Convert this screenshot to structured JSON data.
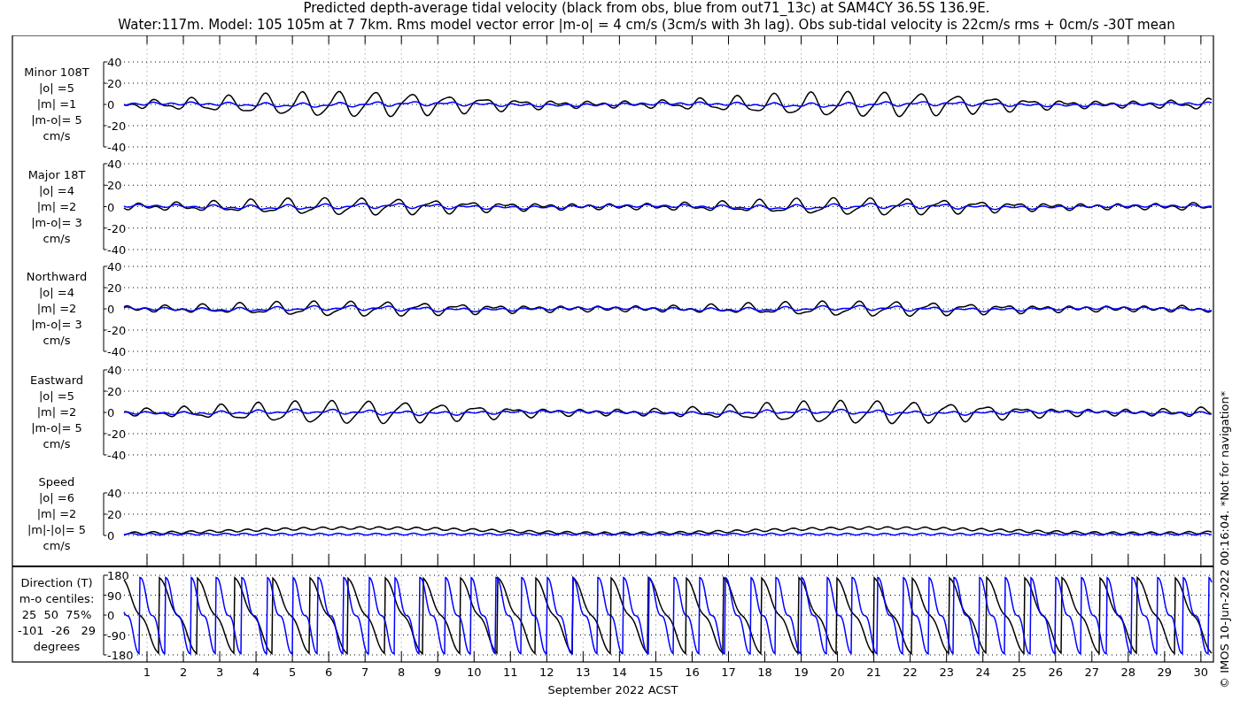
{
  "title_lines": [
    "Predicted depth-average tidal velocity (black from obs, blue from out71_13c) at SAM4CY 36.5S 136.9E.",
    "Water:117m. Model: 105 105m at 7 7km. Rms model vector error |m-o| = 4 cm/s (3cm/s with 3h lag). Obs sub-tidal velocity is 22cm/s rms + 0cm/s -30T mean"
  ],
  "panels": [
    {
      "kind": "velocity",
      "label_lines": [
        "Minor 108T",
        "|o| =5",
        "|m| =1",
        "|m-o|= 5",
        "cm/s"
      ],
      "yticks": [
        "40",
        "20",
        "0",
        "-20",
        "-40"
      ]
    },
    {
      "kind": "velocity",
      "label_lines": [
        "Major 18T",
        "|o| =4",
        "|m| =2",
        "|m-o|= 3",
        "cm/s"
      ],
      "yticks": [
        "40",
        "20",
        "0",
        "-20",
        "-40"
      ]
    },
    {
      "kind": "velocity",
      "label_lines": [
        "Northward",
        "|o| =4",
        "|m| =2",
        "|m-o|= 3",
        "cm/s"
      ],
      "yticks": [
        "40",
        "20",
        "0",
        "-20",
        "-40"
      ]
    },
    {
      "kind": "velocity",
      "label_lines": [
        "Eastward",
        "|o| =5",
        "|m| =2",
        "|m-o|= 5",
        "cm/s"
      ],
      "yticks": [
        "40",
        "20",
        "0",
        "-20",
        "-40"
      ]
    },
    {
      "kind": "speed",
      "label_lines": [
        "Speed",
        "|o| =6",
        "|m| =2",
        "|m|-|o|= 5",
        "cm/s"
      ],
      "yticks": [
        "40",
        "20",
        "0"
      ]
    },
    {
      "kind": "direction",
      "label_lines": [
        "Direction (T)",
        "m-o centiles:",
        "25  50  75%",
        "-101  -26   29",
        "degrees"
      ],
      "yticks": [
        "180",
        "90",
        "0",
        "-90",
        "-180"
      ]
    }
  ],
  "x_labels": [
    "1",
    "2",
    "3",
    "4",
    "5",
    "6",
    "7",
    "8",
    "9",
    "10",
    "11",
    "12",
    "13",
    "14",
    "15",
    "16",
    "17",
    "18",
    "19",
    "20",
    "21",
    "22",
    "23",
    "24",
    "25",
    "26",
    "27",
    "28",
    "29",
    "30"
  ],
  "xlabel": "September 2022 ACST",
  "side_note": "© IMOS 10-Jun-2022 00:16:04. *Not for navigation*"
}
